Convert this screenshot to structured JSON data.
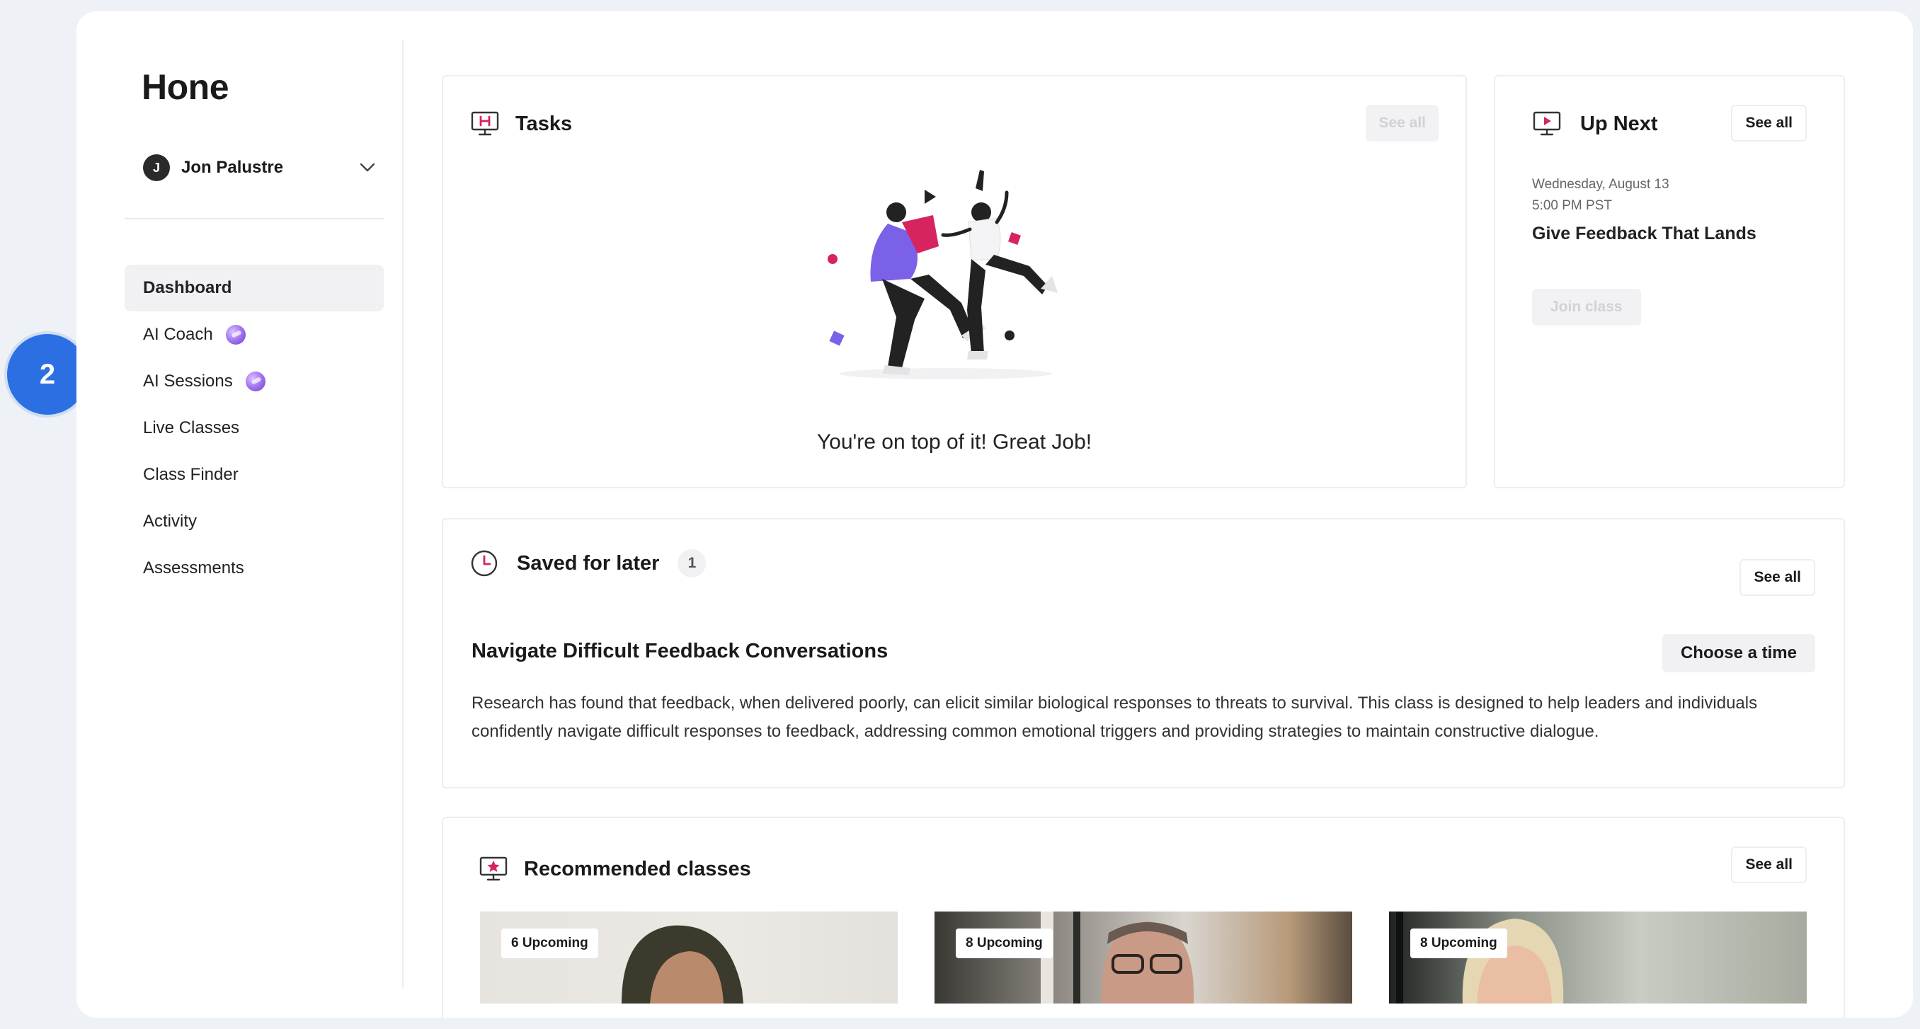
{
  "app": {
    "logo": "Hone"
  },
  "user": {
    "initial": "J",
    "name": "Jon Palustre"
  },
  "nav": [
    {
      "label": "Dashboard",
      "active": true,
      "ai": false
    },
    {
      "label": "AI Coach",
      "active": false,
      "ai": true
    },
    {
      "label": "AI Sessions",
      "active": false,
      "ai": true
    },
    {
      "label": "Live Classes",
      "active": false,
      "ai": false
    },
    {
      "label": "Class Finder",
      "active": false,
      "ai": false
    },
    {
      "label": "Activity",
      "active": false,
      "ai": false
    },
    {
      "label": "Assessments",
      "active": false,
      "ai": false
    }
  ],
  "step_marker": {
    "number": "2"
  },
  "tasks": {
    "title": "Tasks",
    "see_all": "See all",
    "empty_message": "You're on top of it! Great Job!"
  },
  "up_next": {
    "title": "Up Next",
    "see_all": "See all",
    "date": "Wednesday, August 13",
    "time": "5:00 PM PST",
    "class_title": "Give Feedback That Lands",
    "join_label": "Join class"
  },
  "saved": {
    "title": "Saved for later",
    "count": "1",
    "see_all": "See all",
    "class_title": "Navigate Difficult Feedback Conversations",
    "choose_label": "Choose a time",
    "description": "Research has found that feedback, when delivered poorly, can elicit similar biological responses to threats to survival. This class is designed to help leaders and individuals confidently navigate difficult responses to feedback, addressing common emotional triggers and providing strategies to maintain constructive dialogue."
  },
  "recommended": {
    "title": "Recommended classes",
    "see_all": "See all",
    "cards": [
      {
        "badge": "6 Upcoming"
      },
      {
        "badge": "8 Upcoming"
      },
      {
        "badge": "8 Upcoming"
      }
    ]
  },
  "colors": {
    "accent_blue": "#2b6fe3",
    "brand_pink": "#d6245f",
    "illustration_purple": "#7b61e8"
  }
}
